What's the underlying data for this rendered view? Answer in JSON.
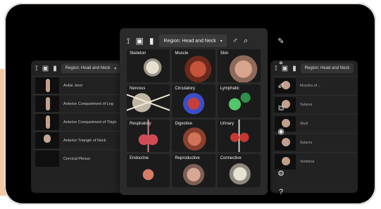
{
  "center_panel": {
    "region_label": "Region: Head and Neck",
    "tiles": [
      {
        "label": "Skeleton",
        "art": "skeleton"
      },
      {
        "label": "Muscle",
        "art": "muscle"
      },
      {
        "label": "Skin",
        "art": "skin"
      },
      {
        "label": "Nervous",
        "art": "nervous"
      },
      {
        "label": "Circulatory",
        "art": "circulatory"
      },
      {
        "label": "Lymphatic",
        "art": "lymphatic"
      },
      {
        "label": "Respiratory",
        "art": "respiratory"
      },
      {
        "label": "Digestive",
        "art": "digestive"
      },
      {
        "label": "Urinary",
        "art": "urinary"
      },
      {
        "label": "Endocrine",
        "art": "endocrine"
      },
      {
        "label": "Reproductive",
        "art": "reproductive"
      },
      {
        "label": "Connective",
        "art": "connective"
      }
    ]
  },
  "left_panel": {
    "region_label": "Region: Head and Neck",
    "items": [
      {
        "label": "Ankle Joint",
        "thumb": "leg"
      },
      {
        "label": "Anterior Compartment of Leg",
        "thumb": "leg"
      },
      {
        "label": "Anterior Compartment of Thigh",
        "thumb": "leg"
      },
      {
        "label": "Anterior Triangle of Neck",
        "thumb": "head"
      },
      {
        "label": "Cervical Plexus",
        "thumb": "none"
      }
    ]
  },
  "right_panel": {
    "items": [
      {
        "label": "Muscles of ..."
      },
      {
        "label": "Sutures"
      },
      {
        "label": "Skull"
      },
      {
        "label": "Sutures"
      },
      {
        "label": "Vertebral"
      }
    ]
  },
  "tools": {
    "top": [
      "pen-icon",
      "pin-icon",
      "highlighter-icon",
      "share-icon",
      "camera-icon"
    ],
    "bottom": [
      "settings-icon",
      "help-icon"
    ]
  }
}
